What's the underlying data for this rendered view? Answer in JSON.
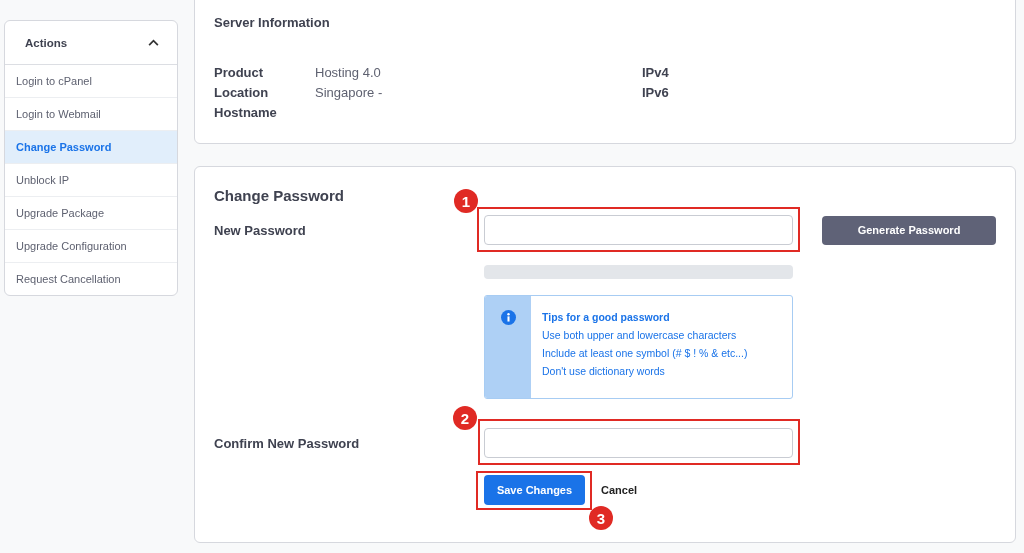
{
  "sidebar": {
    "title": "Actions",
    "expanded": true,
    "items": [
      {
        "label": "Login to cPanel",
        "selected": false
      },
      {
        "label": "Login to Webmail",
        "selected": false
      },
      {
        "label": "Change Password",
        "selected": true
      },
      {
        "label": "Unblock IP",
        "selected": false
      },
      {
        "label": "Upgrade Package",
        "selected": false
      },
      {
        "label": "Upgrade Configuration",
        "selected": false
      },
      {
        "label": "Request Cancellation",
        "selected": false
      }
    ]
  },
  "server_info": {
    "title": "Server Information",
    "left": [
      {
        "label": "Product",
        "value": "Hosting 4.0"
      },
      {
        "label": "Location",
        "value": "Singapore -"
      },
      {
        "label": "Hostname"
      }
    ],
    "right": [
      {
        "label": "IPv4"
      },
      {
        "label": "IPv6"
      }
    ]
  },
  "change_password": {
    "title": "Change Password",
    "new_password_label": "New Password",
    "generate_button": "Generate Password",
    "strength_meter": {
      "level": 0
    },
    "tips": {
      "title": "Tips for a good password",
      "items": [
        "Use both upper and lowercase characters",
        "Include at least one symbol (# $ ! % & etc...)",
        "Don't use dictionary words"
      ]
    },
    "confirm_label": "Confirm New Password",
    "save_button": "Save Changes",
    "cancel_button": "Cancel"
  },
  "annotations": [
    {
      "number": "1"
    },
    {
      "number": "2"
    },
    {
      "number": "3"
    }
  ]
}
